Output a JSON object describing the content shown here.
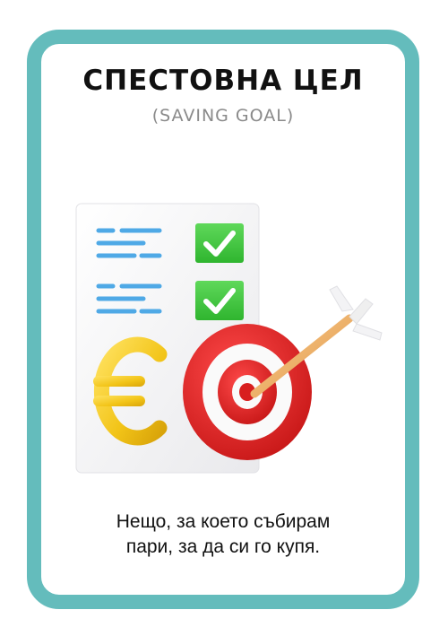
{
  "card": {
    "title": "СПЕСТОВНА ЦЕЛ",
    "subtitle": "(SAVING GOAL)",
    "caption_line1": "Нещо, за което събирам",
    "caption_line2": "пари, за да си го купя.",
    "frame_color": "#64bcbc"
  },
  "illustration": {
    "icons": [
      "document-icon",
      "checkmark-icon",
      "euro-icon",
      "target-icon",
      "arrow-icon"
    ],
    "colors": {
      "lines": "#4fa9e6",
      "check_box": "#3cc63c",
      "euro": "#f2c418",
      "target_red": "#d81e1e",
      "arrow_shaft": "#f0b070"
    }
  }
}
